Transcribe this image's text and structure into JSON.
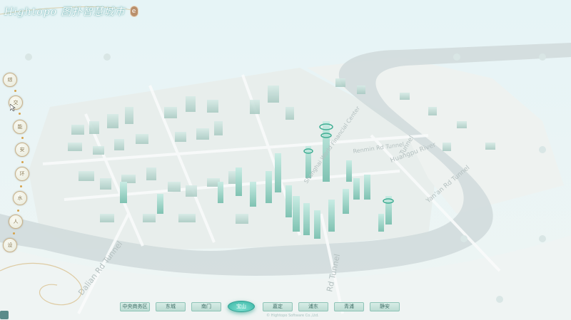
{
  "header": {
    "title": "Hightopo 图扑智慧城市",
    "badge": "e"
  },
  "side_nav": {
    "items": [
      {
        "label": "综"
      },
      {
        "label": "交"
      },
      {
        "label": "能"
      },
      {
        "label": "安"
      },
      {
        "label": "环"
      },
      {
        "label": "水"
      },
      {
        "label": "人"
      },
      {
        "label": "设"
      }
    ]
  },
  "map": {
    "labels": [
      "Dalian Rd Tunnel",
      "Rd Tunnel",
      "Shanghai World Financial Center",
      "Huangpu River",
      "Tunnel",
      "Yan'an Rd Tunnel",
      "Renmin Rd Tunnel"
    ]
  },
  "bottom_tabs": [
    {
      "label": "中央商务区",
      "active": false
    },
    {
      "label": "东城",
      "active": false
    },
    {
      "label": "南门",
      "active": false
    },
    {
      "label": "宝山",
      "active": true
    },
    {
      "label": "嘉定",
      "active": false
    },
    {
      "label": "浦东",
      "active": false
    },
    {
      "label": "青浦",
      "active": false
    },
    {
      "label": "静安",
      "active": false
    }
  ],
  "footer": {
    "text": "© Hightopo Software Co.,Ltd."
  },
  "colors": {
    "accent": "#36b3a3",
    "river": "#cfd9db",
    "building": "#9fcfc4",
    "gold": "#c8b18a"
  }
}
